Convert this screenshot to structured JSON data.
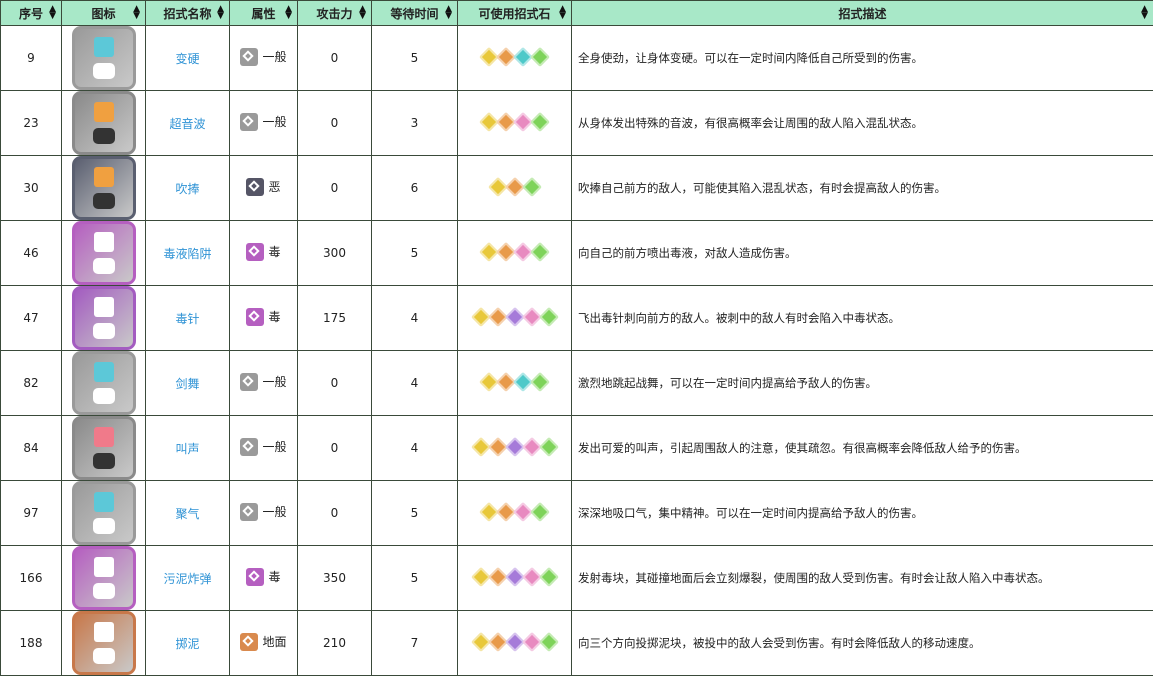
{
  "headers": [
    "序号",
    "图标",
    "招式名称",
    "属性",
    "攻击力",
    "等待时间",
    "可使用招式石",
    "招式描述"
  ],
  "sort_glyph": "▲▼",
  "colors": {
    "header_bg": "#a8e8c8",
    "link": "#2f93d5",
    "type_normal": "#9a9a9a",
    "type_dark": "#555566",
    "type_poison": "#b55fc0",
    "type_ground": "#d98a4e"
  },
  "rows": [
    {
      "no": "9",
      "icon_bg": "#9a9a9a",
      "emblem": "#5cc8d8",
      "name": "变硬",
      "type": "一般",
      "type_color": "#9a9a9a",
      "attack": "0",
      "wait": "5",
      "gems": [
        "#e8c83a",
        "#e89a4a",
        "#4ec9c9",
        "#7ed35a"
      ],
      "desc": "全身使劲，让身体变硬。可以在一定时间内降低自己所受到的伤害。"
    },
    {
      "no": "23",
      "icon_bg": "#8a8a8a",
      "emblem": "#f0a040",
      "name": "超音波",
      "type": "一般",
      "type_color": "#9a9a9a",
      "attack": "0",
      "wait": "3",
      "gems": [
        "#e8c83a",
        "#e89a4a",
        "#e88ac0",
        "#7ed35a"
      ],
      "desc": "从身体发出特殊的音波，有很高概率会让周围的敌人陷入混乱状态。"
    },
    {
      "no": "30",
      "icon_bg": "#5a5f70",
      "emblem": "#f0a040",
      "name": "吹捧",
      "type": "恶",
      "type_color": "#555566",
      "attack": "0",
      "wait": "6",
      "gems": [
        "#e8c83a",
        "#e89a4a",
        "#7ed35a"
      ],
      "desc": "吹捧自己前方的敌人，可能使其陷入混乱状态，有时会提高敌人的伤害。"
    },
    {
      "no": "46",
      "icon_bg": "#b55fc0",
      "emblem": "#ffffff",
      "name": "毒液陷阱",
      "type": "毒",
      "type_color": "#b55fc0",
      "attack": "300",
      "wait": "5",
      "gems": [
        "#e8c83a",
        "#e89a4a",
        "#e88ac0",
        "#7ed35a"
      ],
      "desc": "向自己的前方喷出毒液，对敌人造成伤害。"
    },
    {
      "no": "47",
      "icon_bg": "#a35cc0",
      "emblem": "#ffffff",
      "name": "毒针",
      "type": "毒",
      "type_color": "#b55fc0",
      "attack": "175",
      "wait": "4",
      "gems": [
        "#e8c83a",
        "#e89a4a",
        "#a67bd9",
        "#e88ac0",
        "#7ed35a"
      ],
      "desc": "飞出毒针刺向前方的敌人。被刺中的敌人有时会陷入中毒状态。"
    },
    {
      "no": "82",
      "icon_bg": "#9a9a9a",
      "emblem": "#5cc8d8",
      "name": "剑舞",
      "type": "一般",
      "type_color": "#9a9a9a",
      "attack": "0",
      "wait": "4",
      "gems": [
        "#e8c83a",
        "#e89a4a",
        "#4ec9c9",
        "#7ed35a"
      ],
      "desc": "激烈地跳起战舞，可以在一定时间内提高给予敌人的伤害。"
    },
    {
      "no": "84",
      "icon_bg": "#8a8a8a",
      "emblem": "#f07a8a",
      "name": "叫声",
      "type": "一般",
      "type_color": "#9a9a9a",
      "attack": "0",
      "wait": "4",
      "gems": [
        "#e8c83a",
        "#e89a4a",
        "#a67bd9",
        "#e88ac0",
        "#7ed35a"
      ],
      "desc": "发出可爱的叫声，引起周围敌人的注意，使其疏忽。有很高概率会降低敌人给予的伤害。"
    },
    {
      "no": "97",
      "icon_bg": "#9a9a9a",
      "emblem": "#5cc8d8",
      "name": "聚气",
      "type": "一般",
      "type_color": "#9a9a9a",
      "attack": "0",
      "wait": "5",
      "gems": [
        "#e8c83a",
        "#e89a4a",
        "#e88ac0",
        "#7ed35a"
      ],
      "desc": "深深地吸口气，集中精神。可以在一定时间内提高给予敌人的伤害。"
    },
    {
      "no": "166",
      "icon_bg": "#b55fc0",
      "emblem": "#ffffff",
      "name": "污泥炸弹",
      "type": "毒",
      "type_color": "#b55fc0",
      "attack": "350",
      "wait": "5",
      "gems": [
        "#e8c83a",
        "#e89a4a",
        "#a67bd9",
        "#e88ac0",
        "#7ed35a"
      ],
      "desc": "发射毒块，其碰撞地面后会立刻爆裂，使周围的敌人受到伤害。有时会让敌人陷入中毒状态。"
    },
    {
      "no": "188",
      "icon_bg": "#c8784a",
      "emblem": "#ffffff",
      "name": "掷泥",
      "type": "地面",
      "type_color": "#d98a4e",
      "attack": "210",
      "wait": "7",
      "gems": [
        "#e8c83a",
        "#e89a4a",
        "#a67bd9",
        "#e88ac0",
        "#7ed35a"
      ],
      "desc": "向三个方向投掷泥块，被投中的敌人会受到伤害。有时会降低敌人的移动速度。"
    }
  ]
}
